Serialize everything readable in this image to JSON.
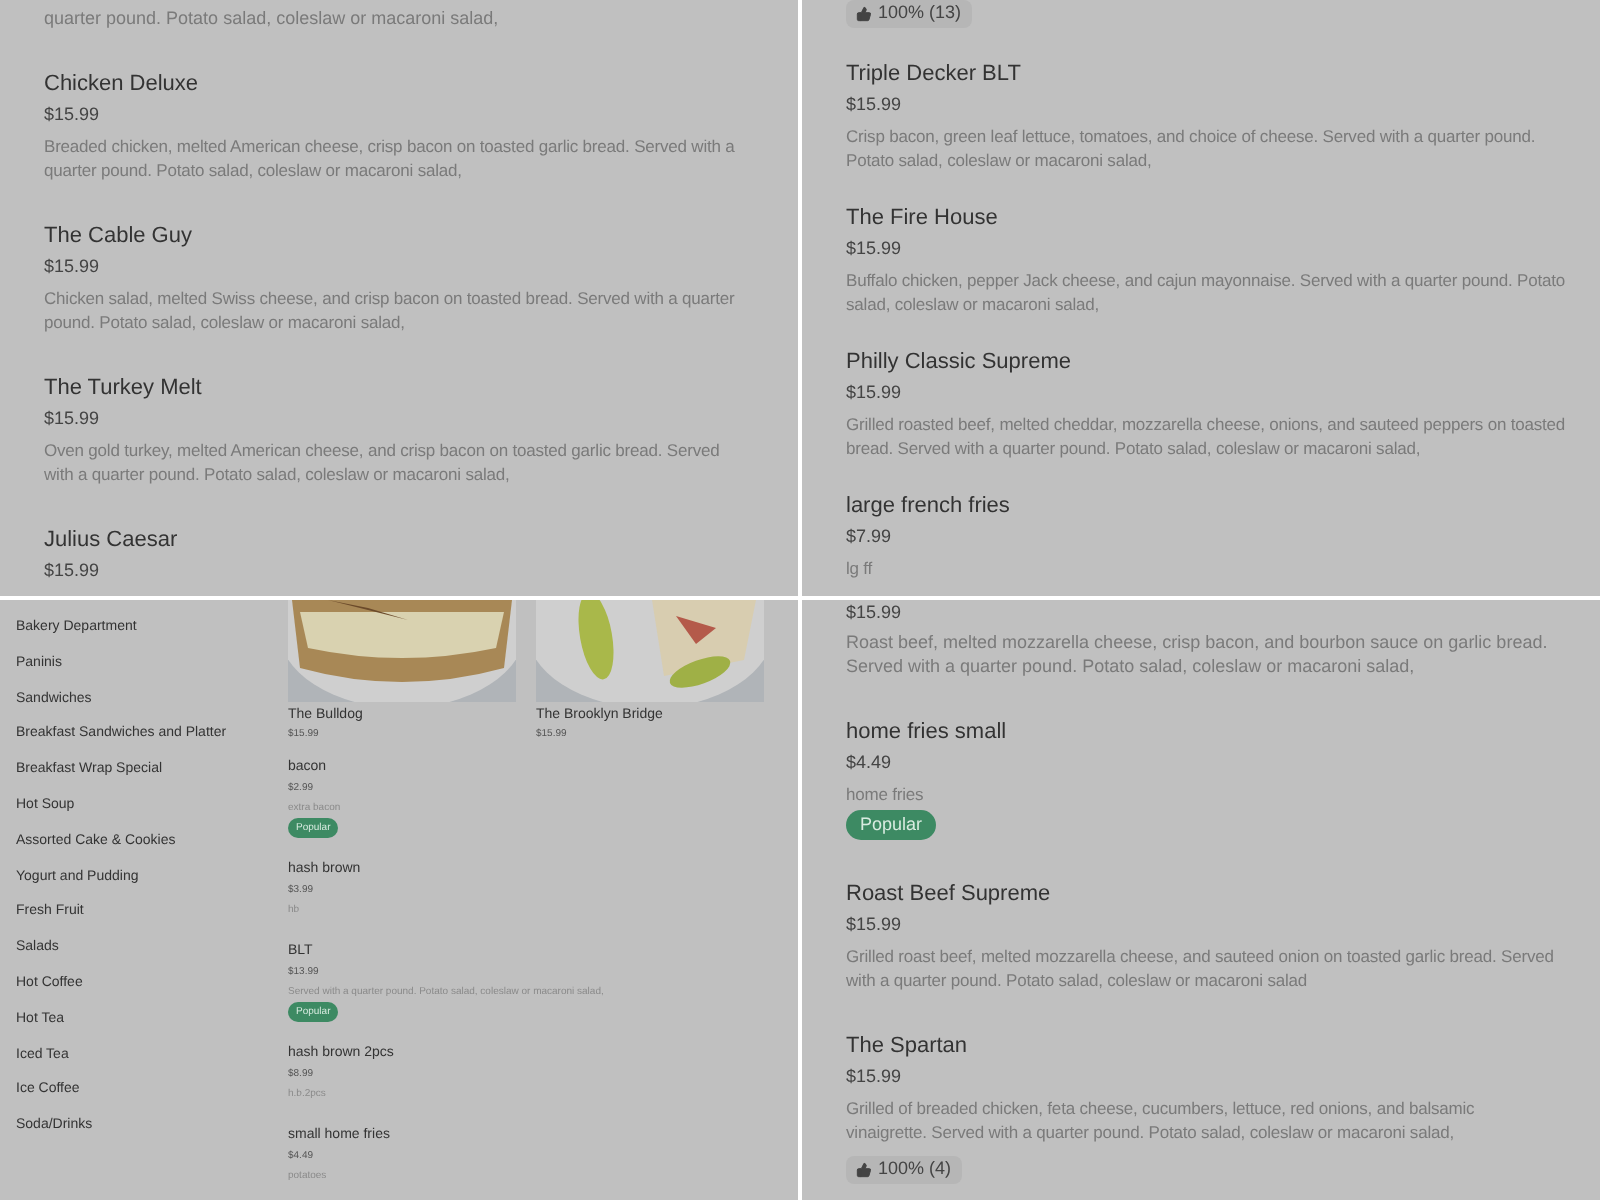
{
  "top_left": {
    "fragment": "quarter pound. Potato salad, coleslaw or macaroni salad,",
    "items": [
      {
        "name": "Chicken Deluxe",
        "price": "$15.99",
        "description": "Breaded chicken, melted American cheese, crisp bacon on toasted garlic bread. Served with a quarter pound. Potato salad, coleslaw or macaroni salad,"
      },
      {
        "name": "The Cable Guy",
        "price": "$15.99",
        "description": "Chicken salad, melted Swiss cheese, and crisp bacon on toasted bread. Served with a quarter pound. Potato salad, coleslaw or macaroni salad,"
      },
      {
        "name": "The Turkey Melt",
        "price": "$15.99",
        "description": "Oven gold turkey, melted American cheese, and crisp bacon on toasted garlic bread. Served with a quarter pound. Potato salad, coleslaw or macaroni salad,"
      },
      {
        "name": "Julius Caesar",
        "price": "$15.99"
      }
    ]
  },
  "top_right": {
    "rating": "100% (13)",
    "items": [
      {
        "name": "Triple Decker BLT",
        "price": "$15.99",
        "description": "Crisp bacon, green leaf lettuce, tomatoes, and choice of cheese. Served with a quarter pound. Potato salad, coleslaw or macaroni salad,"
      },
      {
        "name": "The Fire House",
        "price": "$15.99",
        "description": "Buffalo chicken, pepper Jack cheese, and cajun mayonnaise. Served with a quarter pound. Potato salad, coleslaw or macaroni salad,"
      },
      {
        "name": "Philly Classic Supreme",
        "price": "$15.99",
        "description": "Grilled roasted beef, melted cheddar, mozzarella cheese, onions, and sauteed peppers on toasted bread. Served with a quarter pound. Potato salad, coleslaw or macaroni salad,"
      },
      {
        "name": "large french fries",
        "price": "$7.99",
        "description": "lg ff"
      }
    ]
  },
  "bottom_left": {
    "categories": [
      "Bakery Department",
      "Paninis",
      "Sandwiches",
      "Breakfast Sandwiches and Platter",
      "Breakfast Wrap Special",
      "Hot Soup",
      "Assorted Cake & Cookies",
      "Yogurt and Pudding",
      "Fresh Fruit",
      "Salads",
      "Hot Coffee",
      "Hot Tea",
      "Iced Tea",
      "Ice Coffee",
      "Soda/Drinks"
    ],
    "featured": [
      {
        "kind": "picture",
        "name": "The Bulldog",
        "price": "$15.99"
      },
      {
        "kind": "picture",
        "name": "The Brooklyn Bridge",
        "price": "$15.99"
      }
    ],
    "items": [
      {
        "name": "bacon",
        "price": "$2.99",
        "description": "extra bacon",
        "badge": "Popular"
      },
      {
        "name": "hash brown",
        "price": "$3.99",
        "description": "hb"
      },
      {
        "name": "BLT",
        "price": "$13.99",
        "description": "Served with a quarter pound. Potato salad, coleslaw or macaroni salad,",
        "badge": "Popular"
      },
      {
        "name": "hash brown 2pcs",
        "price": "$8.99",
        "description": "h.b.2pcs"
      },
      {
        "name": "small home fries",
        "price": "$4.49",
        "description": "potatoes"
      }
    ]
  },
  "bottom_right": {
    "fragment_price": "$15.99",
    "fragment_description": "Roast beef, melted mozzarella cheese, crisp bacon, and bourbon sauce on garlic bread. Served with a quarter pound. Potato salad, coleslaw or macaroni salad,",
    "items": [
      {
        "name": "home fries small",
        "price": "$4.49",
        "description": "home fries",
        "badge": "Popular"
      },
      {
        "name": "Roast Beef Supreme",
        "price": "$15.99",
        "description": "Grilled roast beef, melted mozzarella cheese, and sauteed onion on toasted garlic bread. Served with a quarter pound. Potato salad, coleslaw or macaroni salad"
      },
      {
        "name": "The Spartan",
        "price": "$15.99",
        "description": "Grilled of breaded chicken, feta cheese, cucumbers, lettuce, red onions, and balsamic vinaigrette. Served with a quarter pound. Potato salad, coleslaw or macaroni salad,",
        "rating": "100% (4)"
      }
    ]
  }
}
